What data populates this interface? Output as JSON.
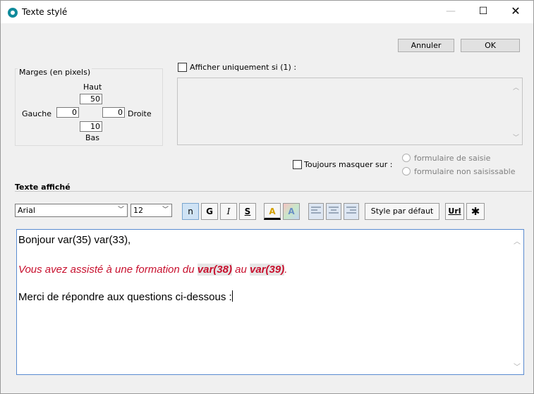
{
  "window": {
    "title": "Texte stylé",
    "controls": {
      "minimize": "—",
      "maximize": "☐",
      "close": "✕"
    }
  },
  "actions": {
    "cancel_label": "Annuler",
    "ok_label": "OK"
  },
  "margins": {
    "legend": "Marges (en pixels)",
    "top_label": "Haut",
    "top_value": "50",
    "left_label": "Gauche",
    "left_value": "0",
    "right_label": "Droite",
    "right_value": "0",
    "bottom_label": "Bas",
    "bottom_value": "10"
  },
  "condition": {
    "checkbox_label": "Afficher uniquement si (1) :",
    "checked": false
  },
  "hide": {
    "checkbox_label": "Toujours masquer sur :",
    "checked": false,
    "options": [
      "formulaire de saisie",
      "formulaire non saisissable"
    ]
  },
  "section": {
    "title": "Texte affiché"
  },
  "toolbar": {
    "font": "Arial",
    "size": "12",
    "normal": "n",
    "bold": "G",
    "italic": "I",
    "underline": "S",
    "text_color_letter": "A",
    "bg_color_letter": "A",
    "default_style": "Style par défaut",
    "url": "Url"
  },
  "editor": {
    "line1": "Bonjour var(35) var(33),",
    "line2_prefix": "Vous avez assisté à une formation du ",
    "line2_var1": "var(38)",
    "line2_mid": " au ",
    "line2_var2": "var(39)",
    "line2_suffix": ".",
    "line3": "Merci de répondre aux questions ci-dessous :"
  },
  "colors": {
    "accent": "#0f8a9b",
    "emphasis_red": "#c8102e"
  }
}
